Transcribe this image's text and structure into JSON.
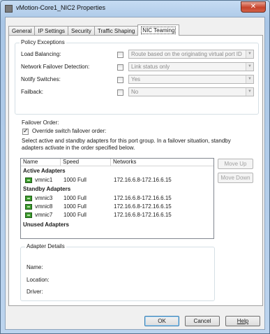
{
  "window": {
    "title": "vMotion-Core1_NIC2 Properties",
    "close_label": "✕"
  },
  "tabs": [
    {
      "label": "General"
    },
    {
      "label": "IP Settings"
    },
    {
      "label": "Security"
    },
    {
      "label": "Traffic Shaping"
    },
    {
      "label": "NIC Teaming"
    }
  ],
  "policy": {
    "group_label": "Policy Exceptions",
    "rows": [
      {
        "label": "Load Balancing:",
        "value": "Route based on the originating virtual port ID",
        "checked": false
      },
      {
        "label": "Network Failover Detection:",
        "value": "Link status only",
        "checked": false
      },
      {
        "label": "Notify Switches:",
        "value": "Yes",
        "checked": false
      },
      {
        "label": "Failback:",
        "value": "No",
        "checked": false
      }
    ]
  },
  "failover": {
    "label": "Failover Order:",
    "override_label": "Override switch failover order:",
    "override_checked": true,
    "description": "Select active and standby adapters for this port group.  In a failover situation, standby adapters activate  in the order specified below."
  },
  "adapter_list": {
    "columns": [
      "Name",
      "Speed",
      "Networks"
    ],
    "active_header": "Active Adapters",
    "active": [
      {
        "name": "vmnic1",
        "speed": "1000 Full",
        "networks": "172.16.6.8-172.16.6.15"
      }
    ],
    "standby_header": "Standby Adapters",
    "standby": [
      {
        "name": "vmnic3",
        "speed": "1000 Full",
        "networks": "172.16.6.8-172.16.6.15"
      },
      {
        "name": "vmnic8",
        "speed": "1000 Full",
        "networks": "172.16.6.8-172.16.6.15"
      },
      {
        "name": "vmnic7",
        "speed": "1000 Full",
        "networks": "172.16.6.8-172.16.6.15"
      }
    ],
    "unused_header": "Unused Adapters"
  },
  "order_buttons": {
    "move_up": "Move Up",
    "move_down": "Move Down"
  },
  "details": {
    "group_label": "Adapter Details",
    "name_label": "Name:",
    "location_label": "Location:",
    "driver_label": "Driver:"
  },
  "footer": {
    "ok": "OK",
    "cancel": "Cancel",
    "help": "Help"
  }
}
